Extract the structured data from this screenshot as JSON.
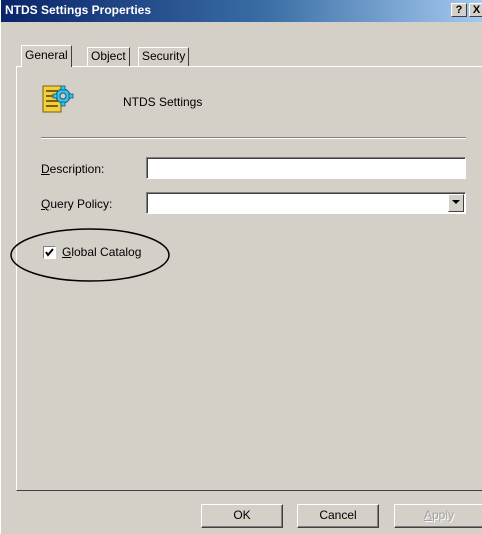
{
  "window": {
    "title": "NTDS Settings Properties",
    "help_label": "?",
    "close_label": "X"
  },
  "tabs": [
    {
      "label": "General",
      "active": true
    },
    {
      "label": "Object",
      "active": false
    },
    {
      "label": "Security",
      "active": false
    }
  ],
  "general": {
    "object_icon": "ntds-settings-icon",
    "object_name": "NTDS Settings",
    "description_label_hotkey": "D",
    "description_label_rest": "escription:",
    "description_value": "",
    "query_policy_label_hotkey": "Q",
    "query_policy_label_rest": "uery Policy:",
    "query_policy_value": "",
    "global_catalog_hotkey": "G",
    "global_catalog_rest": "lobal Catalog",
    "global_catalog_checked": true
  },
  "buttons": {
    "ok_label": "OK",
    "cancel_label": "Cancel",
    "apply_hotkey": "A",
    "apply_rest": "pply"
  },
  "colors": {
    "titlebar_start": "#0a246a",
    "titlebar_end": "#a6caf0",
    "face": "#d4d0c8"
  }
}
